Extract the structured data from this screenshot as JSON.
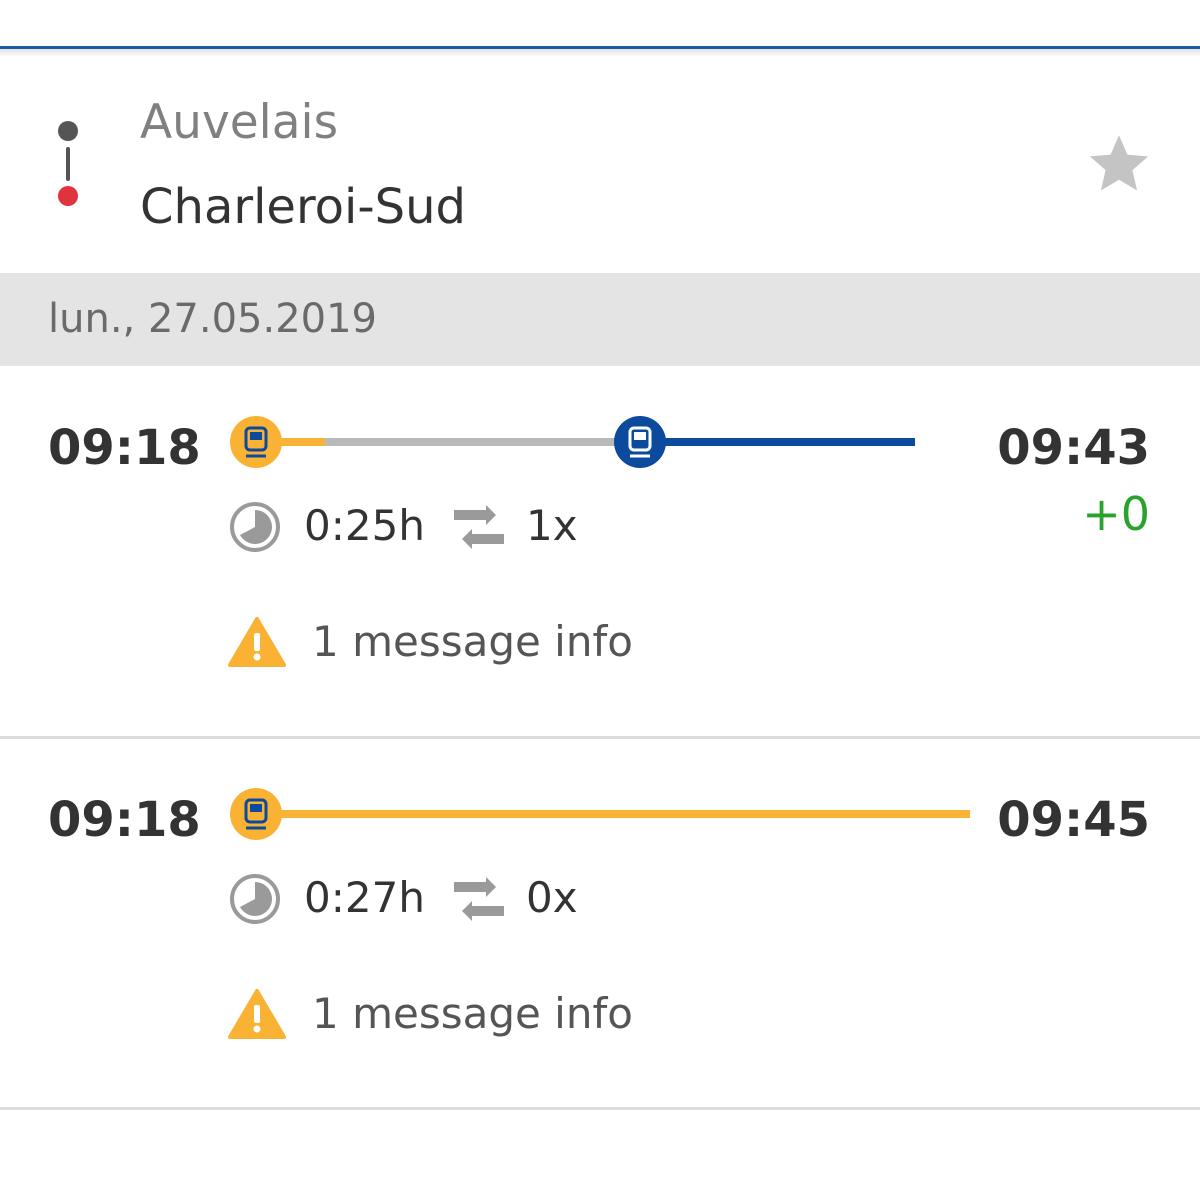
{
  "route": {
    "from": "Auvelais",
    "to": "Charleroi-Sud",
    "favorite_icon": "star-icon"
  },
  "date": "lun., 27.05.2019",
  "connections": [
    {
      "departure": "09:18",
      "arrival": "09:43",
      "delay": "+0",
      "duration": "0:25h",
      "transfers": "1x",
      "message": "1 message info",
      "legs": [
        {
          "type": "train",
          "color": "#f9b233",
          "progress_share": 0.13
        },
        {
          "type": "train",
          "color": "#0b4a9c",
          "progress_share": 0.57
        }
      ]
    },
    {
      "departure": "09:18",
      "arrival": "09:45",
      "delay": "",
      "duration": "0:27h",
      "transfers": "0x",
      "message": "1 message info",
      "legs": [
        {
          "type": "train",
          "color": "#f9b233",
          "progress_share": 1.0
        }
      ]
    }
  ],
  "colors": {
    "accent": "#1a5aa6",
    "train_local": "#f9b233",
    "train_ic": "#0b4a9c",
    "on_time": "#2aa32e",
    "warning": "#f9b233",
    "destination_dot": "#e1333d"
  },
  "icons": {
    "clock": "clock-icon",
    "transfer": "transfer-icon",
    "warning": "warning-icon",
    "train": "train-icon"
  }
}
